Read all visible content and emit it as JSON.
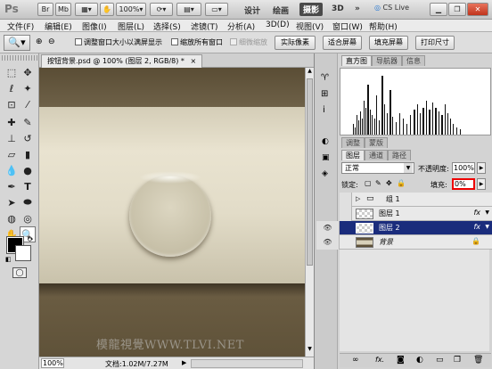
{
  "app": {
    "logo": "Ps",
    "app_buttons": [
      "Br",
      "Mb"
    ],
    "zoom_select": "100%",
    "workspaces": [
      "设计",
      "绘画",
      "摄影",
      "3D"
    ],
    "cs_live": "CS Live"
  },
  "menubar": [
    "文件(F)",
    "编辑(E)",
    "图像(I)",
    "图层(L)",
    "选择(S)",
    "滤镜(T)",
    "分析(A)",
    "3D(D)",
    "视图(V)",
    "窗口(W)",
    "帮助(H)"
  ],
  "options": {
    "resize_windows": "调整窗口大小以满屏显示",
    "zoom_all": "缩放所有窗口",
    "scrubby": "细微缩放",
    "actual_pixels": "实际像素",
    "fit_screen": "适合屏幕",
    "fill_screen": "填充屏幕",
    "print_size": "打印尺寸"
  },
  "document": {
    "tab_title": "按钮背景.psd @ 100% (图层 2, RGB/8) *",
    "close": "×",
    "zoom": "100%",
    "doc_size": "文档:1.02M/7.27M",
    "watermark": "模龍視覺WWW.TLVI.NET"
  },
  "panels": {
    "top_tabs": [
      "直方图",
      "导航器",
      "信息"
    ],
    "layer_tabs": [
      "图层",
      "通道",
      "路径"
    ],
    "adjust_tabs": [
      "调整",
      "蒙版"
    ],
    "blend_mode": "正常",
    "opacity_label": "不透明度:",
    "opacity_value": "100%",
    "lock_label": "锁定:",
    "fill_label": "填充:",
    "fill_value": "0%",
    "layers": [
      {
        "name": "组 1",
        "type": "group"
      },
      {
        "name": "图层 1",
        "type": "layer",
        "fx": "fx"
      },
      {
        "name": "图层 2",
        "type": "layer",
        "fx": "fx",
        "selected": true
      },
      {
        "name": "背景",
        "type": "background"
      }
    ]
  },
  "colors": {
    "canvas_dark": "#5e5139",
    "canvas_light": "#e6e0cc",
    "selection": "#1a2c7c"
  }
}
